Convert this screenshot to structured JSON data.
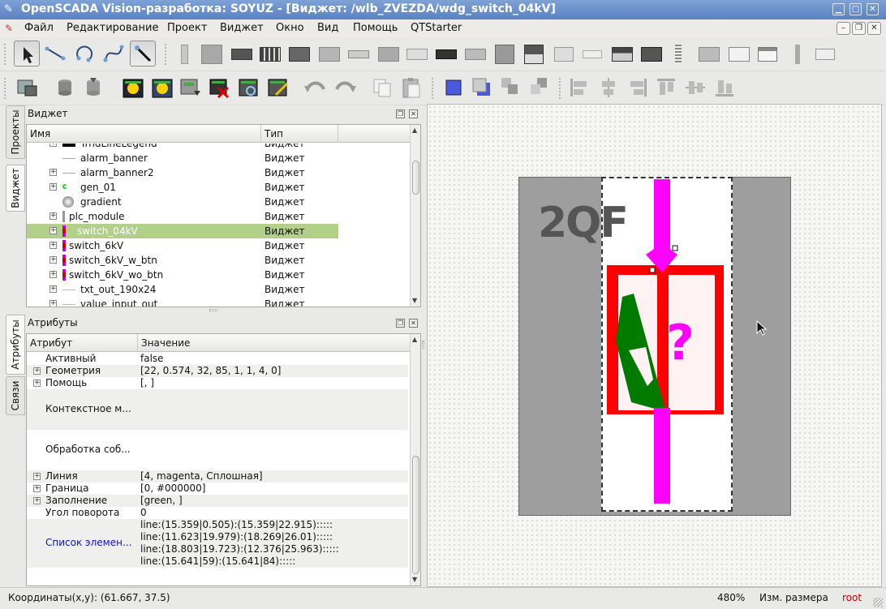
{
  "window": {
    "title": "OpenSCADA Vision-разработка: SOYUZ - [Виджет: /wlb_ZVEZDA/wdg_switch_04kV]"
  },
  "menubar": {
    "items": [
      "Файл",
      "Редактирование",
      "Проект",
      "Виджет",
      "Окно",
      "Вид",
      "Помощь",
      "QTStarter"
    ]
  },
  "tabs": {
    "projects": "Проекты",
    "widgets": "Виджет",
    "attributes": "Атрибуты",
    "links": "Связи"
  },
  "widget_dock": {
    "title": "Виджет",
    "col_name": "Имя",
    "col_type": "Тип",
    "rows": [
      {
        "name": "TrndLineLegend",
        "type": "Виджет",
        "expandable": true,
        "icon": "black-rect-icon"
      },
      {
        "name": "alarm_banner",
        "type": "Виджет",
        "expandable": false,
        "icon": "line-icon"
      },
      {
        "name": "alarm_banner2",
        "type": "Виджет",
        "expandable": true,
        "icon": "line-icon"
      },
      {
        "name": "gen_01",
        "type": "Виджет",
        "expandable": true,
        "icon": "gen-icon"
      },
      {
        "name": "gradient",
        "type": "Виджет",
        "expandable": false,
        "icon": "gradient-icon"
      },
      {
        "name": "plc_module",
        "type": "Виджет",
        "expandable": true,
        "icon": "module-icon"
      },
      {
        "name": "switch_04kV",
        "type": "Виджет",
        "expandable": true,
        "icon": "switch-icon",
        "selected": true
      },
      {
        "name": "switch_6kV",
        "type": "Виджет",
        "expandable": true,
        "icon": "switch-icon"
      },
      {
        "name": "switch_6kV_w_btn",
        "type": "Виджет",
        "expandable": true,
        "icon": "switch-icon"
      },
      {
        "name": "switch_6kV_wo_btn",
        "type": "Виджет",
        "expandable": true,
        "icon": "switch-icon"
      },
      {
        "name": "txt_out_190x24",
        "type": "Виджет",
        "expandable": true,
        "icon": "text-icon"
      },
      {
        "name": "value_input_out",
        "type": "Виджет",
        "expandable": true,
        "icon": "text-icon"
      }
    ]
  },
  "attr_dock": {
    "title": "Атрибуты",
    "col_name": "Атрибут",
    "col_value": "Значение",
    "rows": [
      {
        "name": "Активный",
        "value": "false",
        "expandable": false
      },
      {
        "name": "Геометрия",
        "value": "[22, 0.574, 32, 85, 1, 1, 4, 0]",
        "expandable": true
      },
      {
        "name": "Помощь",
        "value": "[, ]",
        "expandable": true
      },
      {
        "name": "Контекстное м...",
        "value": "",
        "expandable": false
      },
      {
        "name": "Обработка соб...",
        "value": "",
        "expandable": false
      },
      {
        "name": "Линия",
        "value": "[4, magenta, Сплошная]",
        "expandable": true
      },
      {
        "name": "Граница",
        "value": "[0, #000000]",
        "expandable": true
      },
      {
        "name": "Заполнение",
        "value": "[green, ]",
        "expandable": true
      },
      {
        "name": "Угол поворота",
        "value": "0",
        "expandable": false
      },
      {
        "name": "Список элемен...",
        "value": "",
        "expandable": false,
        "link": true,
        "lines": [
          "line:(15.359|0.505):(15.359|22.915):::::",
          "line:(11.623|19.979):(18.269|26.01):::::",
          "line:(18.803|19.723):(12.376|25.963):::::",
          "line:(15.641|59):(15.641|84):::::"
        ]
      }
    ]
  },
  "canvas": {
    "label": "2QF",
    "question": "?"
  },
  "statusbar": {
    "coords": "Координаты(x,y): (61.667, 37.5)",
    "zoom": "480%",
    "mode": "Изм. размера",
    "user": "root"
  },
  "colors": {
    "selection": "#b2d08a",
    "magenta": "#ff00ff",
    "red": "#ff0000",
    "green": "#007a00",
    "link": "#1010cc",
    "user": "#cc0000"
  }
}
